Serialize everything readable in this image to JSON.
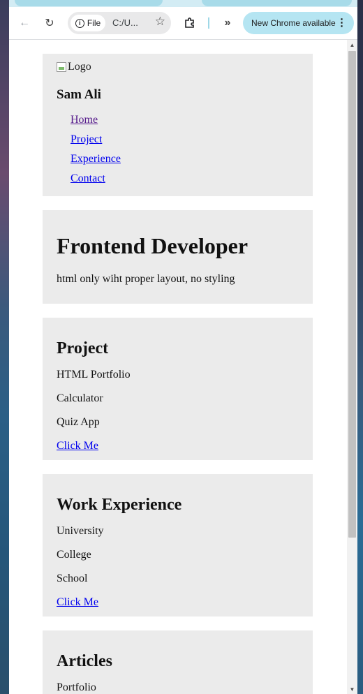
{
  "browser": {
    "url": "C:/U...",
    "site_chip": "File",
    "update_label": "New Chrome available",
    "accent": "#b5e5f2"
  },
  "header": {
    "logo_alt": "Logo",
    "name": "Sam Ali",
    "nav": [
      {
        "label": "Home"
      },
      {
        "label": "Project"
      },
      {
        "label": "Experience"
      },
      {
        "label": "Contact"
      }
    ]
  },
  "hero": {
    "title": "Frontend Developer",
    "subtitle": "html only wiht proper layout, no styling"
  },
  "projects": {
    "heading": "Project",
    "items": [
      "HTML Portfolio",
      "Calculator",
      "Quiz App"
    ],
    "link": "Click Me"
  },
  "experience": {
    "heading": "Work Experience",
    "items": [
      "University",
      "College",
      "School"
    ],
    "link": "Click Me"
  },
  "articles": {
    "heading": "Articles",
    "items": [
      "Portfolio"
    ]
  }
}
